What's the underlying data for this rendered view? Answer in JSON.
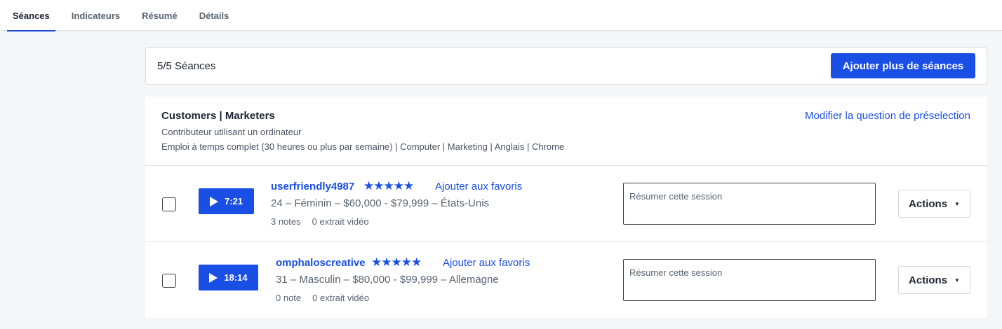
{
  "tabs": [
    {
      "label": "Séances",
      "active": true
    },
    {
      "label": "Indicateurs",
      "active": false
    },
    {
      "label": "Résumé",
      "active": false
    },
    {
      "label": "Détails",
      "active": false
    }
  ],
  "sessions_bar": {
    "count_label": "5/5 Séances",
    "add_button": "Ajouter plus de séances"
  },
  "audience": {
    "title": "Customers | Marketers",
    "subtitle": "Contributeur utilisant un ordinateur",
    "criteria": "Emploi à temps complet (30 heures ou plus par semaine) | Computer | Marketing | Anglais | Chrome",
    "edit_link": "Modifier la question de préselection"
  },
  "sessions": [
    {
      "duration": "7:21",
      "username": "userfriendly4987",
      "stars": "★★★★★",
      "rating": 5,
      "favorite_label": "Ajouter aux favoris",
      "demographics": "24 – Féminin – $60,000 - $79,999 – États-Unis",
      "notes": "3 notes",
      "clips": "0 extrait vidéo",
      "summary_placeholder": "Résumer cette session",
      "actions_label": "Actions",
      "checked": false
    },
    {
      "duration": "18:14",
      "username": "omphaloscreative",
      "stars": "★★★★★",
      "rating": 5,
      "favorite_label": "Ajouter aux favoris",
      "demographics": "31 – Masculin – $80,000 - $99,999 – Allemagne",
      "notes": "0 note",
      "clips": "0 extrait vidéo",
      "summary_placeholder": "Résumer cette session",
      "actions_label": "Actions",
      "checked": false
    }
  ],
  "colors": {
    "accent": "#1a4fe6",
    "background": "#f4f6f7",
    "text": "#1c2430",
    "muted": "#5a6472"
  }
}
